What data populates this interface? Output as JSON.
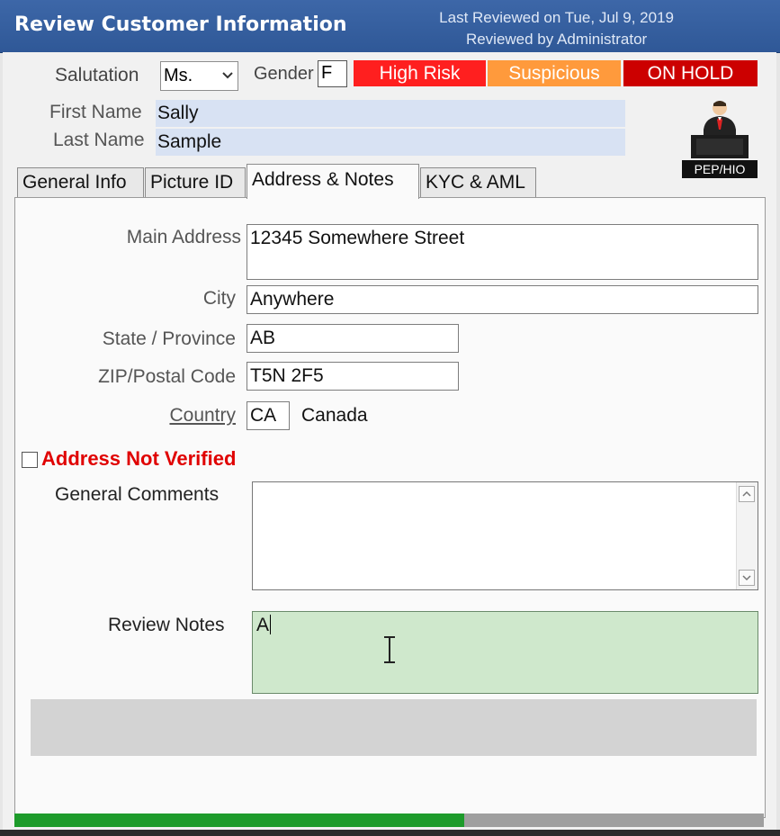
{
  "window": {
    "title": "Review Customer Information",
    "last_reviewed": "Last Reviewed on Tue, Jul 9, 2019",
    "reviewed_by": "Reviewed by Administrator"
  },
  "header": {
    "salutation_label": "Salutation",
    "salutation_value": "Ms.",
    "gender_label": "Gender",
    "gender_value": "F",
    "flags": [
      {
        "label": "High Risk",
        "color": "#ff1f1f"
      },
      {
        "label": "Suspicious",
        "color": "#ff9a3c"
      },
      {
        "label": "ON HOLD",
        "color": "#cc0000"
      }
    ],
    "first_name_label": "First Name",
    "first_name_value": "Sally",
    "last_name_label": "Last Name",
    "last_name_value": "Sample",
    "pep_badge": "PEP/HIO",
    "pep_icon": "person-at-podium-icon"
  },
  "tabs": [
    {
      "label": "General Info",
      "active": false
    },
    {
      "label": "Picture ID",
      "active": false
    },
    {
      "label": "Address & Notes",
      "active": true
    },
    {
      "label": "KYC & AML",
      "active": false
    }
  ],
  "address": {
    "main_address_label": "Main Address",
    "main_address_value": "12345 Somewhere Street",
    "city_label": "City",
    "city_value": "Anywhere",
    "state_label": "State / Province",
    "state_value": "AB",
    "zip_label": "ZIP/Postal Code",
    "zip_value": "T5N 2F5",
    "country_label": "Country",
    "country_code": "CA",
    "country_name": "Canada",
    "address_not_verified_label": "Address Not Verified",
    "address_not_verified_checked": false
  },
  "notes": {
    "general_comments_label": "General Comments",
    "general_comments_value": "",
    "review_notes_label": "Review Notes",
    "review_notes_value": "A"
  },
  "progress": {
    "fraction": 0.6
  },
  "colors": {
    "title_bar": "#2f5897",
    "review_notes_bg": "#cfe8cc",
    "warning_text": "#e00000",
    "progress_fill": "#1d9b2b"
  }
}
